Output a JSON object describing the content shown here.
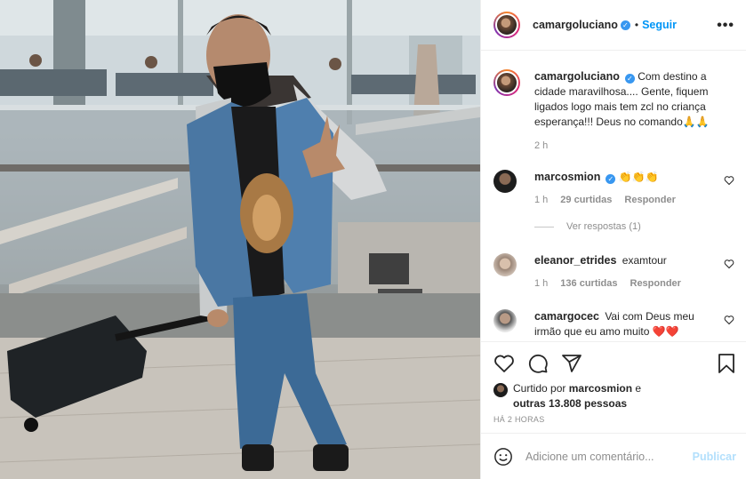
{
  "post": {
    "author": "camargoluciano",
    "follow_label": "Seguir",
    "separator": "•",
    "more_label": "•••"
  },
  "caption": {
    "user": "camargoluciano",
    "text": "Com destino a cidade maravilhosa.... Gente, fiquem ligados logo mais tem zcl no criança esperança!!! Deus no comando🙏🙏",
    "time": "2 h"
  },
  "comments": [
    {
      "user": "marcosmion",
      "verified": true,
      "text": "👏👏👏",
      "time": "1 h",
      "likes": "29 curtidas",
      "reply": "Responder",
      "view_replies": "Ver respostas (1)"
    },
    {
      "user": "eleanor_etrides",
      "verified": false,
      "text": "examtour",
      "time": "1 h",
      "likes": "136 curtidas",
      "reply": "Responder"
    },
    {
      "user": "camargocec",
      "verified": false,
      "text": "Vai com Deus meu irmão que eu amo muito ❤️❤️"
    }
  ],
  "likes": {
    "prefix": "Curtido por",
    "user": "marcosmion",
    "middle": "e",
    "others": "outras 13.808 pessoas"
  },
  "posted_ago": "HÁ 2 HORAS",
  "composer": {
    "placeholder": "Adicione um comentário...",
    "post_label": "Publicar"
  },
  "icons": {
    "like": "heart-icon",
    "comment": "comment-icon",
    "share": "share-icon",
    "save": "bookmark-icon",
    "emoji": "emoji-icon"
  },
  "colors": {
    "accent": "#0095f6",
    "verified": "#3897f0",
    "muted": "#8e8e8e",
    "post_disabled": "#b2dffc"
  }
}
